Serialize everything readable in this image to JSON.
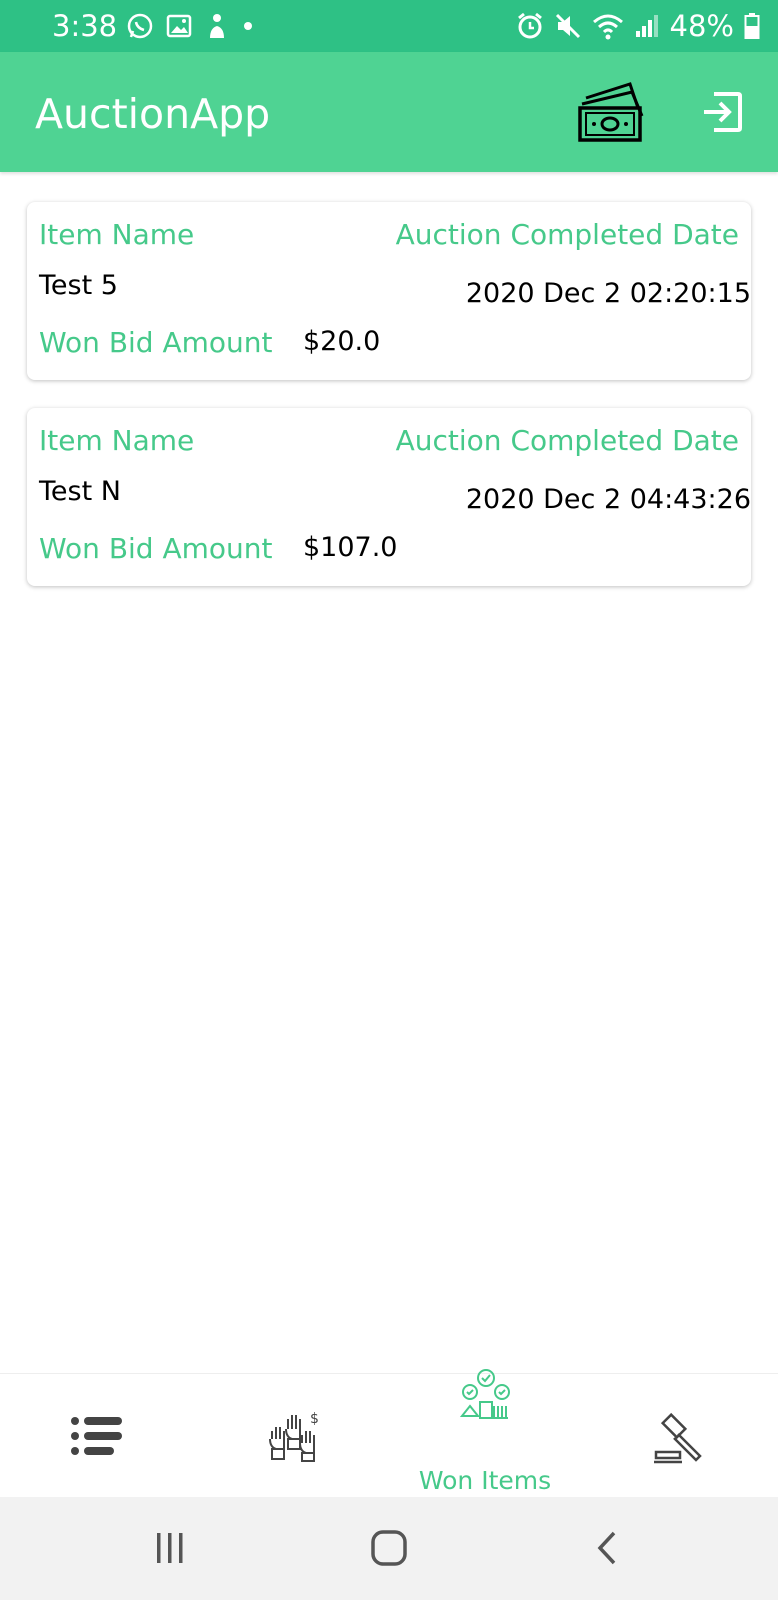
{
  "status_bar": {
    "time": "3:38",
    "battery": "48%"
  },
  "app_bar": {
    "title": "AuctionApp"
  },
  "labels": {
    "item_name": "Item Name",
    "completed_date": "Auction Completed Date",
    "won_bid": "Won Bid Amount"
  },
  "items": [
    {
      "name": "Test 5",
      "date": "2020 Dec 2 02:20:15",
      "amount": "$20.0"
    },
    {
      "name": "Test N",
      "date": "2020 Dec 2 04:43:26",
      "amount": "$107.0"
    }
  ],
  "bottom_nav": {
    "active_label": "Won Items",
    "icons": [
      "list-icon",
      "bids-hands-icon",
      "won-items-icon",
      "gavel-icon"
    ]
  },
  "colors": {
    "status_bar": "#2ec185",
    "app_bar": "#4fd393",
    "accent_text": "#46c98a"
  }
}
